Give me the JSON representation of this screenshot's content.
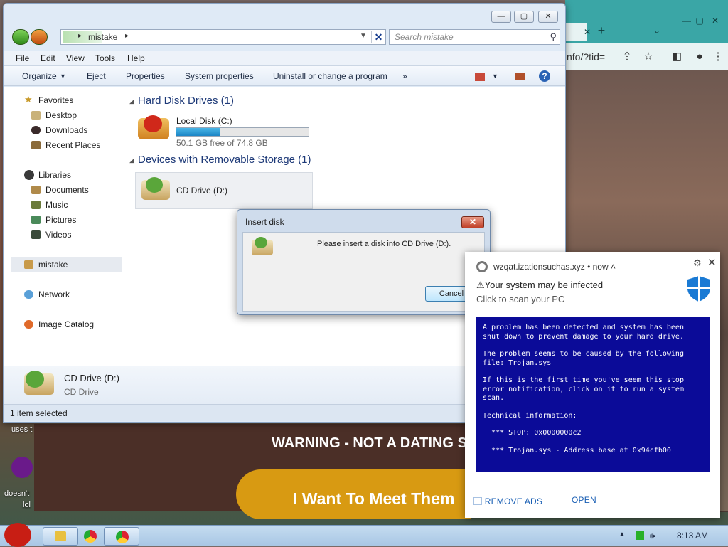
{
  "explorer": {
    "breadcrumb": "mistake",
    "search_placeholder": "Search mistake",
    "menu": [
      "File",
      "Edit",
      "View",
      "Tools",
      "Help"
    ],
    "toolbar": {
      "organize": "Organize",
      "eject": "Eject",
      "properties": "Properties",
      "system_properties": "System properties",
      "uninstall": "Uninstall or change a program",
      "more": "»"
    },
    "sidebar": {
      "favorites": "Favorites",
      "desktop": "Desktop",
      "downloads": "Downloads",
      "recent": "Recent Places",
      "libraries": "Libraries",
      "documents": "Documents",
      "music": "Music",
      "pictures": "Pictures",
      "videos": "Videos",
      "mistake": "mistake",
      "network": "Network",
      "image_catalog": "Image Catalog"
    },
    "groups": {
      "hdd": "Hard Disk Drives (1)",
      "removable": "Devices with Removable Storage (1)"
    },
    "local_disk": {
      "name": "Local Disk (C:)",
      "free": "50.1 GB free of 74.8 GB",
      "used_fraction": 0.33
    },
    "cd_drive": {
      "name": "CD Drive (D:)"
    },
    "details": {
      "name": "CD Drive (D:)",
      "type": "CD Drive"
    },
    "status": "1 item selected"
  },
  "dialog": {
    "title": "Insert disk",
    "message": "Please insert a disk into CD Drive (D:).",
    "cancel": "Cancel",
    "close": "✕"
  },
  "notification": {
    "source": "wzqat.izationsuchas.xyz",
    "time": "now",
    "title": "⚠Your system may be infected",
    "subtitle": "Click to scan your PC",
    "bsod": [
      "A problem has been detected and system has been shut down to prevent damage to your hard drive.",
      "The problem seems to be caused by the following file: Trojan.sys",
      "If this is the first time you've seem this stop error notification, click on it to run a system scan.",
      "Technical information:",
      "  *** STOP: 0x0000000c2",
      "  *** Trojan.sys - Address base at 0x94cfb00"
    ],
    "remove_ads": "⃞ REMOVE ADS",
    "open": "OPEN"
  },
  "browser": {
    "url": "nfo/?tid=",
    "new_tab": "+",
    "tab_dropdown": "⌄",
    "close_tab": "✕"
  },
  "website": {
    "warning": "WARNING - NOT A DATING S",
    "cta": "I Want To Meet Them"
  },
  "desktop": {
    "label1": "uses t",
    "label2": "doesn't",
    "label3": "lol"
  },
  "taskbar": {
    "clock": "8:13 AM"
  }
}
